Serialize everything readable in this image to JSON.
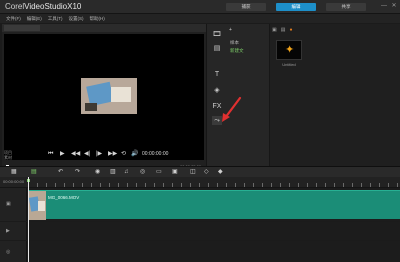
{
  "app": {
    "title_prefix": "Corel",
    "title_main": "VideoStudio",
    "title_version": "X10"
  },
  "steps": [
    {
      "label": "捕获",
      "active": false
    },
    {
      "label": "编辑",
      "active": true
    },
    {
      "label": "共享",
      "active": false
    }
  ],
  "window_controls": {
    "minimize": "—",
    "close": "✕"
  },
  "menu": [
    "文件(F)",
    "编辑(E)",
    "工具(T)",
    "设置(S)",
    "帮助(H)"
  ],
  "player": {
    "tc_left_top": "项目",
    "tc_left_bottom": "素材",
    "timecode": "00:00:00:00",
    "tc_right": "00:00:05:00",
    "buttons": [
      "⏮",
      "▶",
      "◀◀",
      "◀|",
      "|▶",
      "▶▶",
      "⟲",
      "🔊"
    ]
  },
  "toolstrip": [
    {
      "name": "media-icon",
      "glyph": "🎞"
    },
    {
      "name": "instant-project-icon",
      "glyph": "▤"
    },
    {
      "name": "title-icon",
      "glyph": "T"
    },
    {
      "name": "transition-icon",
      "glyph": "◈"
    },
    {
      "name": "filter-icon",
      "glyph": "FX"
    },
    {
      "name": "path-icon",
      "glyph": "⤳"
    }
  ],
  "library": {
    "nav_top": "+",
    "nav_items": [
      {
        "label": "样本",
        "active": false
      },
      {
        "label": "新建文",
        "active": true
      }
    ],
    "toolbar": [
      "▣",
      "▤",
      "●"
    ],
    "tile_label": "Untitled"
  },
  "timeline": {
    "ruler_label": "00:00:00:00",
    "clip_name": "MG_0066.MOV",
    "track1_icon": "▣",
    "track2_icon": "▶",
    "track3_icon": "◎"
  },
  "colors": {
    "accent": "#1d8fc9",
    "clip": "#1b8d77",
    "annotation": "#e03030",
    "active_nav": "#7fd06a"
  }
}
